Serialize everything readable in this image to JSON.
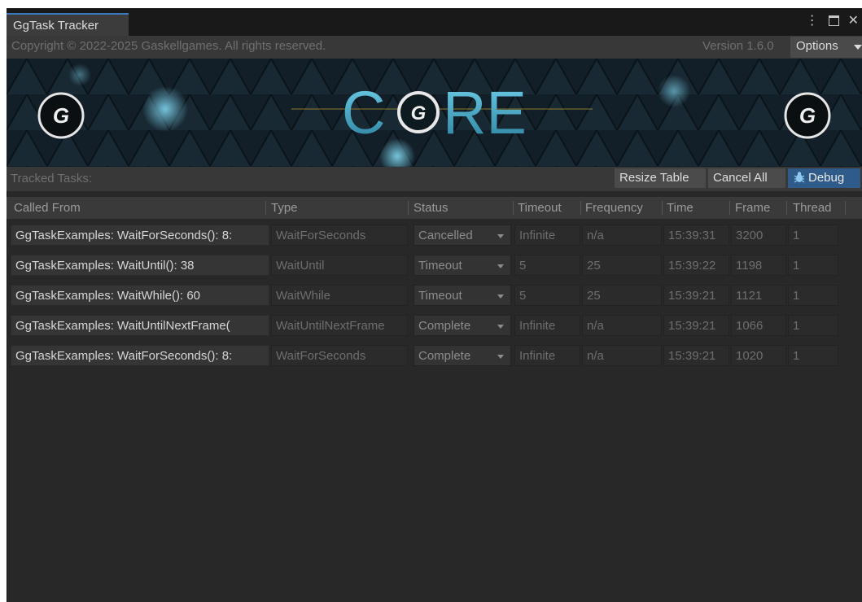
{
  "window": {
    "tab_title": "GgTask Tracker",
    "controls": {
      "menu_glyph": "⋮",
      "close_glyph": "✕"
    }
  },
  "toolbar": {
    "copyright": "Copyright © 2022-2025 Gaskellgames. All rights reserved.",
    "version": "Version 1.6.0",
    "options_label": "Options"
  },
  "banner": {
    "logo_left": "G",
    "logo_center_prefix": "C",
    "logo_center_suffix": "RE",
    "logo_center_mark": "G",
    "logo_right": "G"
  },
  "tasks_bar": {
    "label": "Tracked Tasks:",
    "resize_label": "Resize Table",
    "cancel_all_label": "Cancel All",
    "debug_label": "Debug"
  },
  "columns": [
    "Called From",
    "Type",
    "Status",
    "Timeout",
    "Frequency",
    "Time",
    "Frame",
    "Thread"
  ],
  "rows": [
    {
      "called_from": "GgTaskExamples: WaitForSeconds(): 8:",
      "type": "WaitForSeconds",
      "status": "Cancelled",
      "timeout": "Infinite",
      "frequency": "n/a",
      "time": "15:39:31",
      "frame": "3200",
      "thread": "1"
    },
    {
      "called_from": "GgTaskExamples: WaitUntil(): 38",
      "type": "WaitUntil",
      "status": "Timeout",
      "timeout": "5",
      "frequency": "25",
      "time": "15:39:22",
      "frame": "1198",
      "thread": "1"
    },
    {
      "called_from": "GgTaskExamples: WaitWhile(): 60",
      "type": "WaitWhile",
      "status": "Timeout",
      "timeout": "5",
      "frequency": "25",
      "time": "15:39:21",
      "frame": "1121",
      "thread": "1"
    },
    {
      "called_from": "GgTaskExamples: WaitUntilNextFrame(",
      "type": "WaitUntilNextFrame",
      "status": "Complete",
      "timeout": "Infinite",
      "frequency": "n/a",
      "time": "15:39:21",
      "frame": "1066",
      "thread": "1"
    },
    {
      "called_from": "GgTaskExamples: WaitForSeconds(): 8:",
      "type": "WaitForSeconds",
      "status": "Complete",
      "timeout": "Infinite",
      "frequency": "n/a",
      "time": "15:39:21",
      "frame": "1020",
      "thread": "1"
    }
  ],
  "colors": {
    "accent": "#2f5b8a",
    "tab_highlight": "#3a79bb",
    "panel_bg": "#282828",
    "banner_teal": "#3ea6c4"
  },
  "icons": [
    "menu-dots-icon",
    "maximize-icon",
    "close-icon",
    "dropdown-arrow-icon",
    "debug-bug-icon",
    "gaskellgames-logo-icon"
  ]
}
